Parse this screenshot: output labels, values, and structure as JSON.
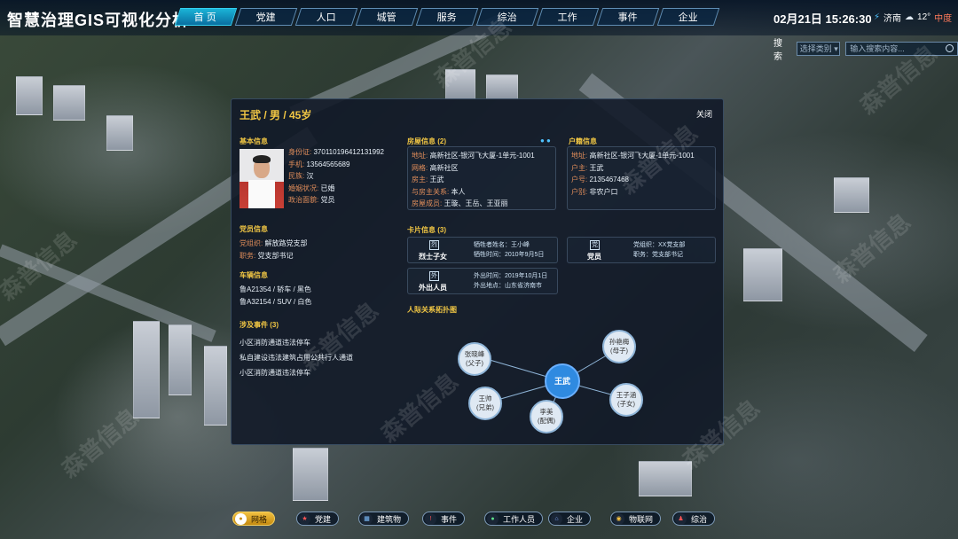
{
  "app_title": "智慧治理GIS可视化分析",
  "nav": [
    "首 页",
    "党建",
    "人口",
    "城管",
    "服务",
    "综治",
    "工作",
    "事件",
    "企业"
  ],
  "datetime": "02月21日 15:26:30",
  "weather": {
    "city": "济南",
    "temp": "12°",
    "aqi": "中度",
    "icon": "cloud-icon"
  },
  "search": {
    "label": "搜索",
    "select": "选择类别",
    "placeholder": "输入搜索内容..."
  },
  "panel": {
    "title": "王武 / 男 / 45岁",
    "close": "关闭",
    "basic": {
      "title": "基本信息",
      "rows": [
        [
          "身份证:",
          "370110196412131992"
        ],
        [
          "手机:",
          "13564565689"
        ],
        [
          "民族:",
          "汉"
        ],
        [
          "婚姻状况:",
          "已婚"
        ],
        [
          "政治面貌:",
          "党员"
        ]
      ]
    },
    "party": {
      "title": "党员信息",
      "rows": [
        [
          "党组织:",
          "解放路党支部"
        ],
        [
          "职务:",
          "党支部书记"
        ]
      ]
    },
    "vehicle": {
      "title": "车辆信息",
      "rows": [
        "鲁A21354 / 轿车 / 黑色",
        "鲁A32154 / SUV / 白色"
      ]
    },
    "events": {
      "title": "涉及事件  (3)",
      "rows": [
        "小区消防通道违法停车",
        "私自建设违法建筑占用公共行人通道",
        "小区消防通道违法停车"
      ]
    },
    "house": {
      "title": "房屋信息  (2)",
      "rows": [
        [
          "地址:",
          "高新社区-银河飞大厦-1单元-1001"
        ],
        [
          "网格:",
          "高新社区"
        ],
        [
          "房主:",
          "王武"
        ],
        [
          "与房主关系:",
          "本人"
        ],
        [
          "房屋成员:",
          "王璇、王岳、王亚丽"
        ]
      ]
    },
    "huji": {
      "title": "户籍信息",
      "rows": [
        [
          "地址:",
          "高新社区-银河飞大厦-1单元-1001"
        ],
        [
          "户主:",
          "王武"
        ],
        [
          "户号:",
          "2135467468"
        ],
        [
          "户别:",
          "非农户口"
        ]
      ]
    },
    "cards": {
      "title": "卡片信息  (3)",
      "items": [
        {
          "icon": "烈",
          "label": "烈士子女",
          "lines": [
            "牺牲者姓名：王小峰",
            "牺牲时间：2010年9月5日"
          ]
        },
        {
          "icon": "党",
          "label": "党员",
          "lines": [
            "党组织：XX党支部",
            "职务：党支部书记"
          ]
        },
        {
          "icon": "外",
          "label": "外出人员",
          "lines": [
            "外出时间：2019年10月1日",
            "外出地点：山东省济南市"
          ]
        }
      ]
    },
    "graph": {
      "title": "人际关系拓扑图",
      "center": "王武",
      "nodes": [
        [
          "张晓峰",
          "(父子)"
        ],
        [
          "孙艳梅",
          "(母子)"
        ],
        [
          "王子涵",
          "(子女)"
        ],
        [
          "李美",
          "(配偶)"
        ],
        [
          "王帅",
          "(兄弟)"
        ]
      ]
    }
  },
  "bottom": [
    "网格",
    "党建",
    "建筑物",
    "事件",
    "工作人员",
    "企业",
    "物联网",
    "综治"
  ],
  "watermark": "森普信息"
}
